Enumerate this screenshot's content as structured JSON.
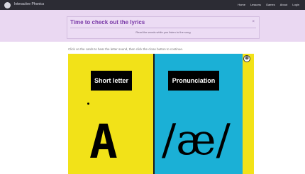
{
  "header": {
    "brand": "Interactive Phonics",
    "nav": [
      "Home",
      "Lessons",
      "Games",
      "About",
      "Login"
    ]
  },
  "banner": {
    "title": "Time to check out the lyrics",
    "subtitle": "Read the words while you listen to the song",
    "close_icon": "×"
  },
  "main": {
    "instructions": "Click on the cards to hear the letter sound, then click the close button to continue."
  },
  "flashcard": {
    "left_label": "Short letter",
    "left_glyph": "A",
    "right_label": "Pronunciation",
    "right_glyph": "/æ/",
    "close_icon": "⊗"
  },
  "colors": {
    "topbar": "#2c2c34",
    "banner": "#ead8f2",
    "title": "#7a3aa8",
    "yellow": "#f2e218",
    "blue": "#1bb0d6"
  }
}
